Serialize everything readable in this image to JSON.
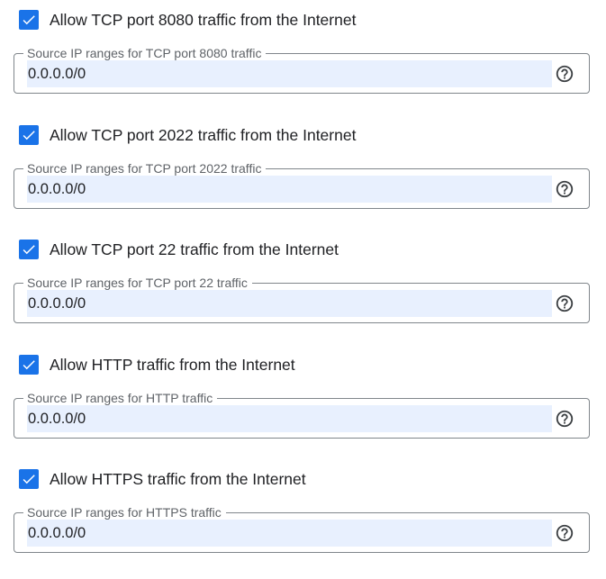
{
  "accent_color": "#1a73e8",
  "autofill_color": "#e8f0fe",
  "rules": [
    {
      "checkbox_label": "Allow TCP port 8080 traffic from the Internet",
      "checked": true,
      "field_label": "Source IP ranges for TCP port 8080 traffic",
      "field_value": "0.0.0.0/0",
      "help_icon": "help-circle-icon"
    },
    {
      "checkbox_label": "Allow TCP port 2022 traffic from the Internet",
      "checked": true,
      "field_label": "Source IP ranges for TCP port 2022 traffic",
      "field_value": "0.0.0.0/0",
      "help_icon": "help-circle-icon"
    },
    {
      "checkbox_label": "Allow TCP port 22 traffic from the Internet",
      "checked": true,
      "field_label": "Source IP ranges for TCP port 22 traffic",
      "field_value": "0.0.0.0/0",
      "help_icon": "help-circle-icon"
    },
    {
      "checkbox_label": "Allow HTTP traffic from the Internet",
      "checked": true,
      "field_label": "Source IP ranges for HTTP traffic",
      "field_value": "0.0.0.0/0",
      "help_icon": "help-circle-icon"
    },
    {
      "checkbox_label": "Allow HTTPS traffic from the Internet",
      "checked": true,
      "field_label": "Source IP ranges for HTTPS traffic",
      "field_value": "0.0.0.0/0",
      "help_icon": "help-circle-icon"
    }
  ]
}
